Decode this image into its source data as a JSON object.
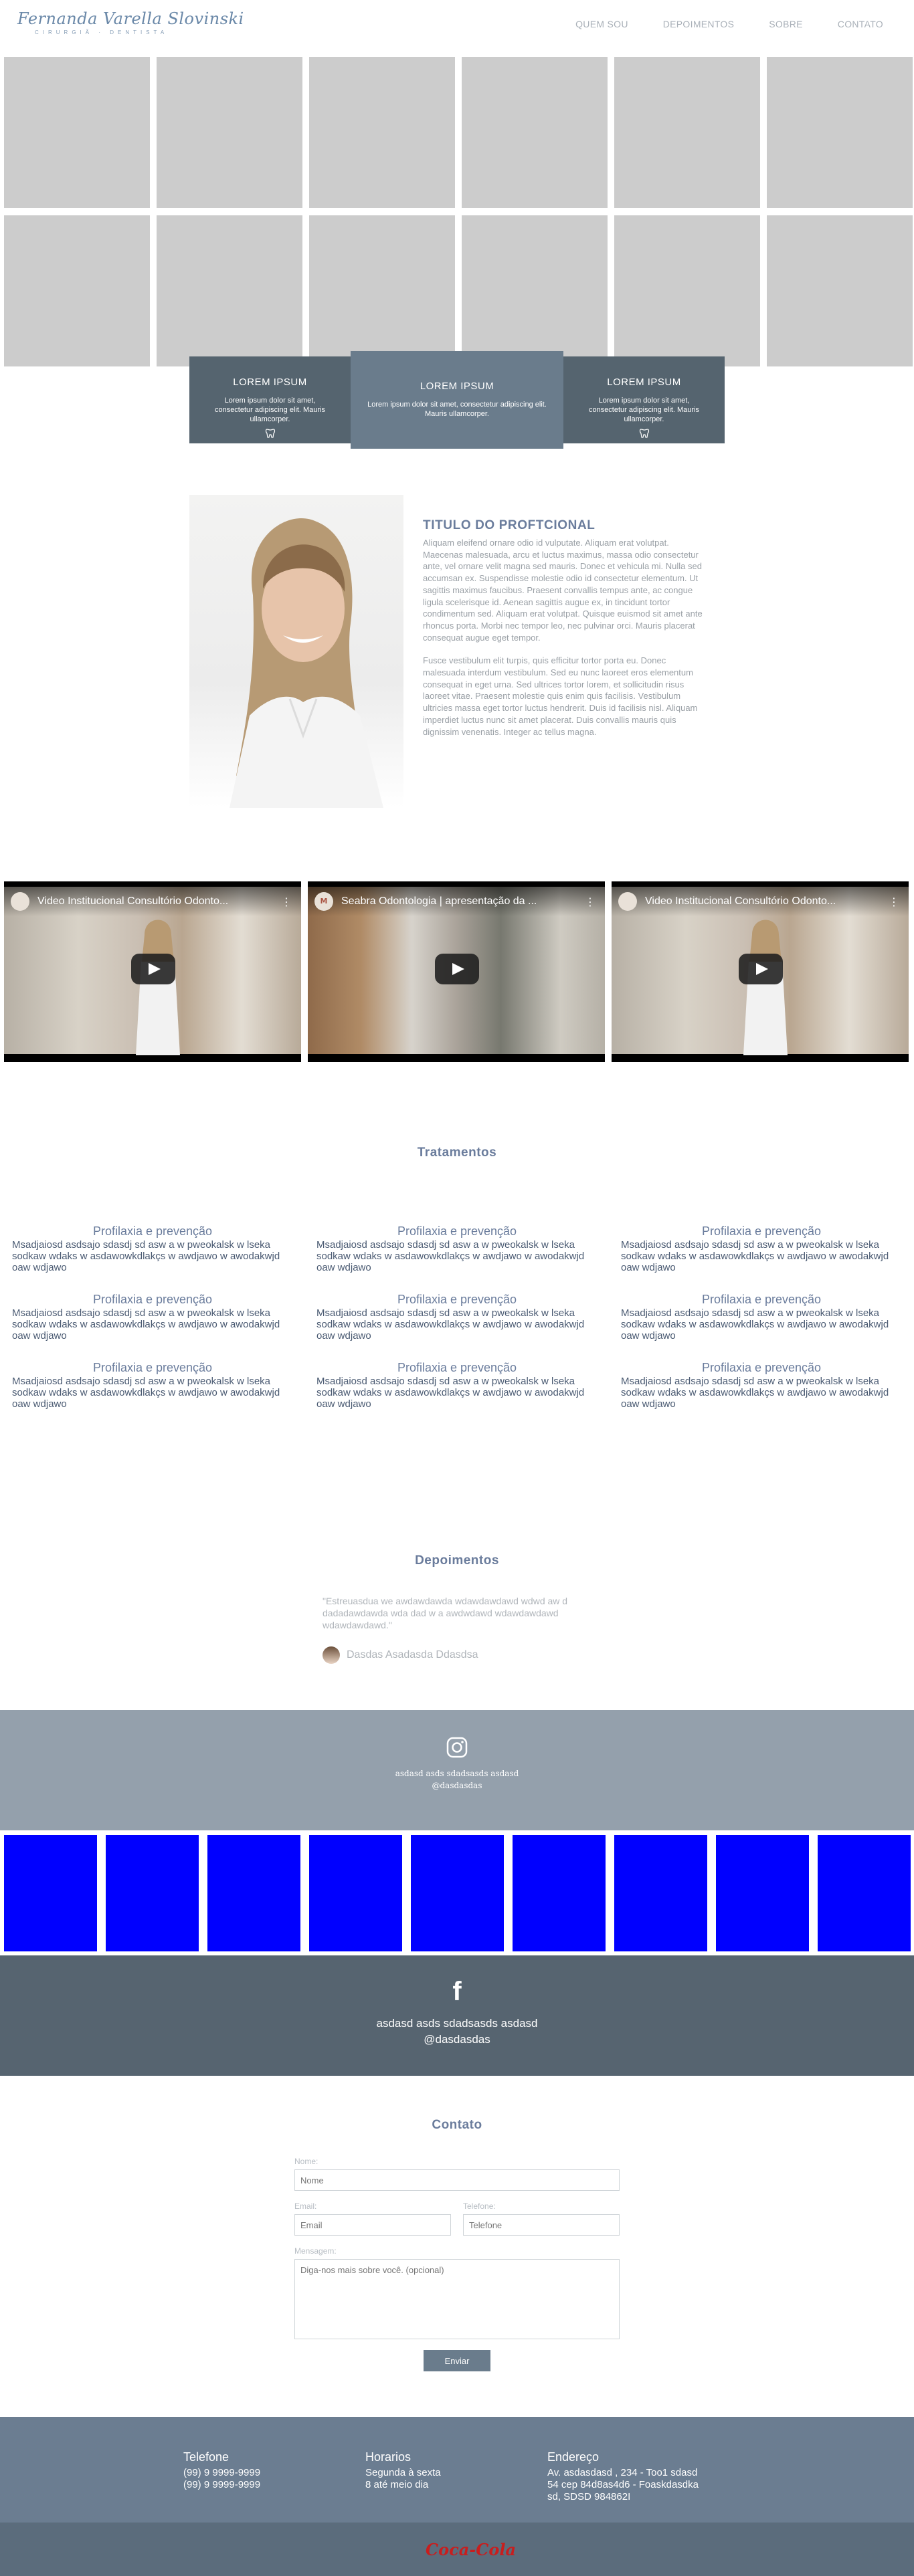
{
  "brand": {
    "name": "Fernanda Varella Slovinski",
    "subtitle": "CIRURGIÃ · DENTISTA"
  },
  "nav": [
    "QUEM SOU",
    "DEPOIMENTOS",
    "SOBRE",
    "CONTATO"
  ],
  "cards": [
    {
      "title": "LOREM IPSUM",
      "text": "Lorem ipsum dolor sit amet, consectetur adipiscing elit. Mauris ullamcorper."
    },
    {
      "title": "LOREM IPSUM",
      "text": "Lorem ipsum dolor sit amet, consectetur adipiscing elit. Mauris ullamcorper."
    },
    {
      "title": "LOREM IPSUM",
      "text": "Lorem ipsum dolor sit amet, consectetur adipiscing elit. Mauris ullamcorper."
    }
  ],
  "about": {
    "title": "TITULO DO PROFTCIONAL",
    "p1": "Aliquam eleifend ornare odio id vulputate. Aliquam erat volutpat. Maecenas malesuada, arcu et luctus maximus, massa odio consectetur ante, vel ornare velit magna sed mauris. Donec et vehicula mi. Nulla sed accumsan ex. Suspendisse molestie odio id consectetur elementum. Ut sagittis maximus faucibus. Praesent convallis tempus ante, ac congue ligula scelerisque id. Aenean sagittis augue ex, in tincidunt tortor condimentum sed. Aliquam erat volutpat. Quisque euismod sit amet ante rhoncus porta. Morbi nec tempor leo, nec pulvinar orci. Mauris placerat consequat augue eget tempor.",
    "p2": "Fusce vestibulum elit turpis, quis efficitur tortor porta eu. Donec malesuada interdum vestibulum. Sed eu nunc laoreet eros elementum consequat in eget urna. Sed ultrices tortor lorem, et sollicitudin risus laoreet vitae. Praesent molestie quis enim quis facilisis. Vestibulum ultricies massa eget tortor luctus hendrerit. Duis id facilisis nisl. Aliquam imperdiet luctus nunc sit amet placerat. Duis convallis mauris quis dignissim venenatis. Integer ac tellus magna."
  },
  "videos": [
    {
      "title": "Video Institucional Consultório Odonto...",
      "avatar": ""
    },
    {
      "title": "Seabra Odontologia | apresentação da ...",
      "avatar": "M"
    },
    {
      "title": "Video Institucional Consultório Odonto...",
      "avatar": ""
    }
  ],
  "treatments": {
    "heading": "Tratamentos",
    "items": [
      {
        "title": "Profilaxia e prevenção",
        "text": "Msadjaiosd asdsajo sdasdj sd asw a w pweokalsk w lseka sodkaw wdaks w asdawowkdlakçs w awdjawo w awodakwjd oaw wdjawo"
      },
      {
        "title": "Profilaxia e prevenção",
        "text": "Msadjaiosd asdsajo sdasdj sd asw a w pweokalsk w lseka sodkaw wdaks w asdawowkdlakçs w awdjawo w awodakwjd oaw wdjawo"
      },
      {
        "title": "Profilaxia e prevenção",
        "text": "Msadjaiosd asdsajo sdasdj sd asw a w pweokalsk w lseka sodkaw wdaks w asdawowkdlakçs w awdjawo w awodakwjd oaw wdjawo"
      },
      {
        "title": "Profilaxia e prevenção",
        "text": "Msadjaiosd asdsajo sdasdj sd asw a w pweokalsk w lseka sodkaw wdaks w asdawowkdlakçs w awdjawo w awodakwjd oaw wdjawo"
      },
      {
        "title": "Profilaxia e prevenção",
        "text": "Msadjaiosd asdsajo sdasdj sd asw a w pweokalsk w lseka sodkaw wdaks w asdawowkdlakçs w awdjawo w awodakwjd oaw wdjawo"
      },
      {
        "title": "Profilaxia e prevenção",
        "text": "Msadjaiosd asdsajo sdasdj sd asw a w pweokalsk w lseka sodkaw wdaks w asdawowkdlakçs w awdjawo w awodakwjd oaw wdjawo"
      },
      {
        "title": "Profilaxia e prevenção",
        "text": "Msadjaiosd asdsajo sdasdj sd asw a w pweokalsk w lseka sodkaw wdaks w asdawowkdlakçs w awdjawo w awodakwjd oaw wdjawo"
      },
      {
        "title": "Profilaxia e prevenção",
        "text": "Msadjaiosd asdsajo sdasdj sd asw a w pweokalsk w lseka sodkaw wdaks w asdawowkdlakçs w awdjawo w awodakwjd oaw wdjawo"
      },
      {
        "title": "Profilaxia e prevenção",
        "text": "Msadjaiosd asdsajo sdasdj sd asw a w pweokalsk w lseka sodkaw wdaks w asdawowkdlakçs w awdjawo w awodakwjd oaw wdjawo"
      }
    ]
  },
  "testimonials": {
    "heading": "Depoimentos",
    "quote": "\"Estreuasdua we awdawdawda wdawdawdawd wdwd aw d dadadawdawda wda dad w a awdwdawd wdawdawdawd wdawdawdawd.\"",
    "author": "Dasdas Asadasda Ddasdsa"
  },
  "instagram": {
    "line1": "asdasd asds sdadsasds asdasd",
    "line2": "@dasdasdas",
    "icon": "instagram-icon"
  },
  "facebook": {
    "letter": "f",
    "line1": "asdasd asds sdadsasds asdasd",
    "line2": "@dasdasdas",
    "icon": "facebook-icon"
  },
  "contact": {
    "heading": "Contato",
    "name_label": "Nome:",
    "name_placeholder": "Nome",
    "email_label": "Email:",
    "email_placeholder": "Email",
    "phone_label": "Telefone:",
    "phone_placeholder": "Telefone",
    "message_label": "Mensagem:",
    "message_placeholder": "Diga-nos mais sobre você. (opcional)",
    "send_label": "Enviar"
  },
  "footer": {
    "phone_title": "Telefone",
    "phone_1": "(99) 9 9999-9999",
    "phone_2": "(99) 9 9999-9999",
    "hours_title": "Horarios",
    "hours_1": "Segunda à sexta",
    "hours_2": "8 até meio dia",
    "address_title": "Endereço",
    "address_1": "Av. asdasdasd , 234 - Too1 sdasd",
    "address_2": "54 cep 84d8as4d6 - Foaskdasdka",
    "address_3": "sd, SDSD 984862I"
  },
  "bottom": {
    "logo_text": "Coca-Cola"
  },
  "colors": {
    "accent": "#6a7c8c",
    "card_dark": "#55646f",
    "footer": "#6b7d91",
    "tile_blue": "#0000ff",
    "gray_tile": "#cccccc",
    "brand_red": "#c81e1e"
  }
}
